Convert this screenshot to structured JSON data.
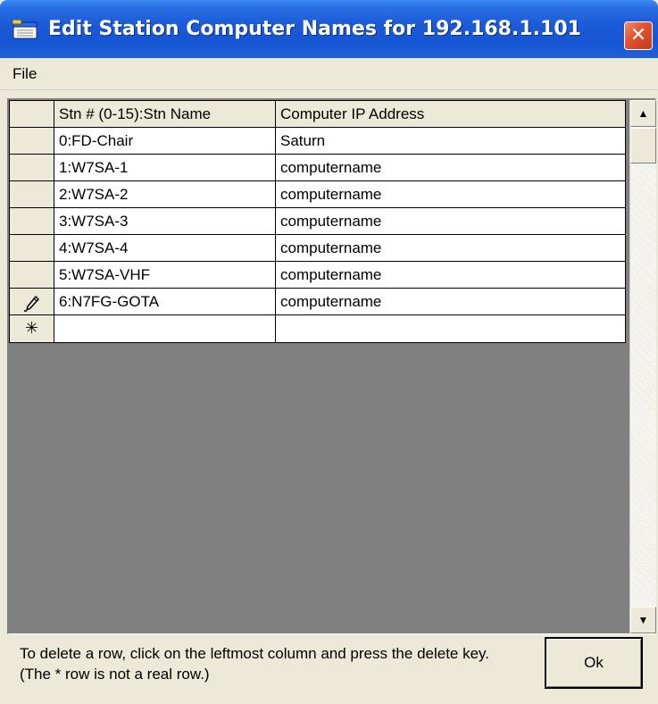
{
  "window": {
    "title": "Edit Station Computer Names for 192.168.1.101",
    "close_glyph": "✕"
  },
  "menu": {
    "items": [
      {
        "label": "File"
      }
    ]
  },
  "grid": {
    "columns": [
      "Stn # (0-15):Stn Name",
      "Computer IP Address"
    ],
    "rows": [
      {
        "station": "0:FD-Chair",
        "computer": "Saturn",
        "indicator": ""
      },
      {
        "station": "1:W7SA-1",
        "computer": "computername",
        "indicator": ""
      },
      {
        "station": "2:W7SA-2",
        "computer": "computername",
        "indicator": ""
      },
      {
        "station": "3:W7SA-3",
        "computer": "computername",
        "indicator": ""
      },
      {
        "station": "4:W7SA-4",
        "computer": "computername",
        "indicator": ""
      },
      {
        "station": "5:W7SA-VHF",
        "computer": "computername",
        "indicator": ""
      },
      {
        "station": "6:N7FG-GOTA",
        "computer": "computername",
        "indicator": "pencil-icon"
      }
    ],
    "new_row": {
      "indicator": "asterisk-icon",
      "glyph": "✳",
      "station": "",
      "computer": ""
    }
  },
  "scrollbar": {
    "up_glyph": "▲",
    "down_glyph": "▼"
  },
  "footer": {
    "instructions": "To delete a row, click on the leftmost column and press the delete key. (The * row is not a real row.)",
    "ok_label": "Ok"
  },
  "colors": {
    "titlebar_blue": "#1655d3",
    "close_red": "#e0522c",
    "dialog_bg": "#ece9d8",
    "grid_bg": "#808080"
  }
}
